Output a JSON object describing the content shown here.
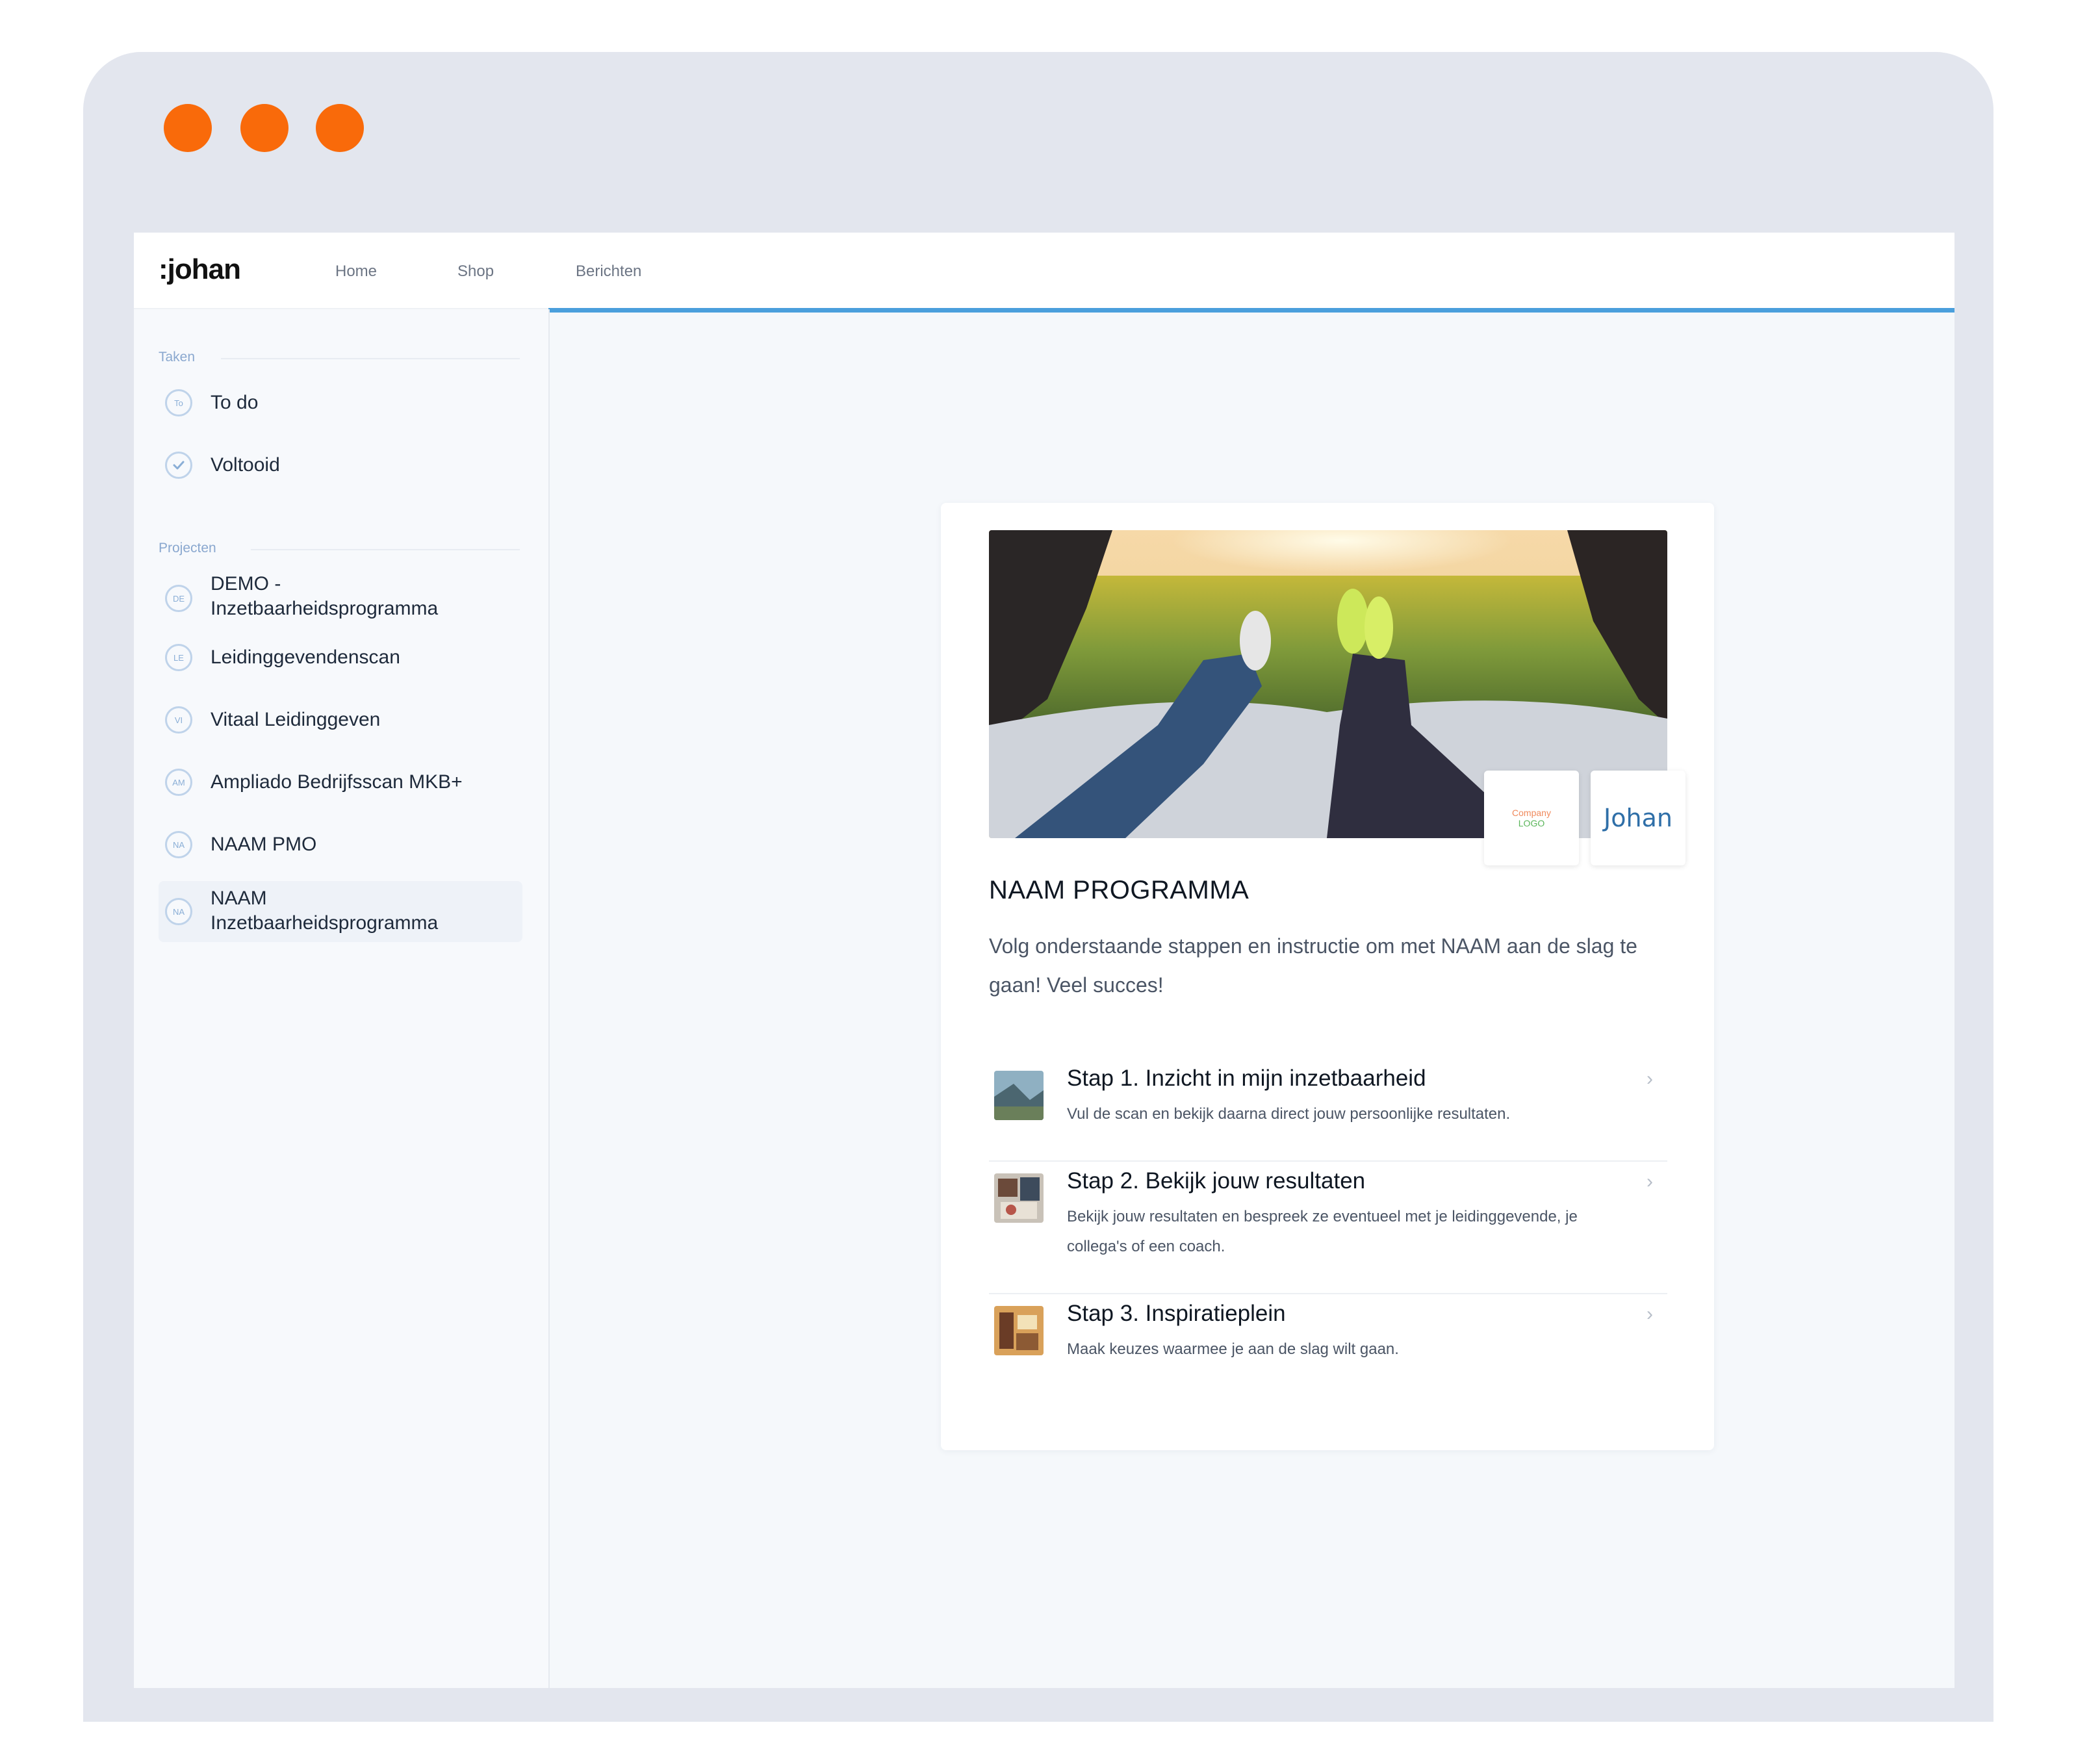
{
  "window": {
    "colors": {
      "chrome": "#e3e6ee",
      "traffic_dot": "#f96a0a",
      "accent": "#4a9fdc"
    }
  },
  "topnav": {
    "logo": ":johan",
    "links": [
      "Home",
      "Shop",
      "Berichten"
    ]
  },
  "sidebar": {
    "sections": [
      {
        "label": "Taken",
        "items": [
          {
            "icon": "To",
            "label": "To do"
          },
          {
            "icon": "check-icon",
            "label": "Voltooid"
          }
        ]
      },
      {
        "label": "Projecten",
        "items": [
          {
            "icon": "DE",
            "label": "DEMO - Inzetbaarheidsprogramma"
          },
          {
            "icon": "LE",
            "label": "Leidinggevendenscan"
          },
          {
            "icon": "VI",
            "label": "Vitaal Leidinggeven"
          },
          {
            "icon": "AM",
            "label": "Ampliado Bedrijfsscan MKB+"
          },
          {
            "icon": "NA",
            "label": "NAAM PMO"
          },
          {
            "icon": "NA",
            "label": "NAAM Inzetbaarheidsprogramma",
            "active": true
          }
        ]
      }
    ]
  },
  "program": {
    "company_logo_top": "Company",
    "company_logo_bottom": "LOGO",
    "johan_logo": "Johan",
    "title": "NAAM PROGRAMMA",
    "intro": "Volg onderstaande stappen en instructie om met NAAM aan de slag te gaan! Veel succes!",
    "steps": [
      {
        "title": "Stap 1. Inzicht in mijn inzetbaarheid",
        "description": "Vul de scan en bekijk daarna direct jouw persoonlijke resultaten."
      },
      {
        "title": "Stap 2. Bekijk jouw resultaten",
        "description": "Bekijk jouw resultaten en bespreek ze eventueel met je leidinggevende, je collega's of een coach."
      },
      {
        "title": "Stap 3. Inspiratieplein",
        "description": "Maak keuzes waarmee je aan de slag wilt gaan."
      }
    ]
  }
}
